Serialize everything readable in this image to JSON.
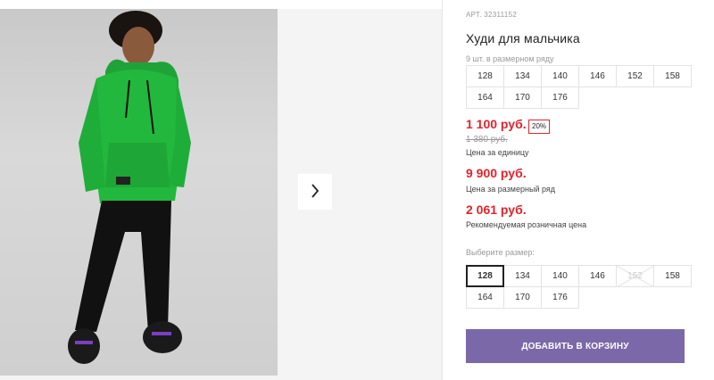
{
  "product": {
    "article_label": "АРТ.",
    "article_number": "32311152",
    "title": "Худи для мальчика",
    "pack_note": "9 шт. в размерном ряду",
    "pack_sizes": [
      "128",
      "134",
      "140",
      "146",
      "152",
      "158",
      "164",
      "170",
      "176"
    ]
  },
  "pricing": {
    "unit_price": "1 100 руб.",
    "discount_badge": "20%",
    "old_price": "1 380 руб.",
    "unit_caption": "Цена за единицу",
    "pack_price": "9 900 руб.",
    "pack_caption": "Цена за размерный ряд",
    "retail_price": "2 061 руб.",
    "retail_caption": "Рекомендуемая розничная цена"
  },
  "size_picker": {
    "label": "Выберите размер:",
    "sizes": [
      {
        "label": "128",
        "state": "selected"
      },
      {
        "label": "134",
        "state": "available"
      },
      {
        "label": "140",
        "state": "available"
      },
      {
        "label": "146",
        "state": "available"
      },
      {
        "label": "152",
        "state": "disabled"
      },
      {
        "label": "158",
        "state": "available"
      },
      {
        "label": "164",
        "state": "available"
      },
      {
        "label": "170",
        "state": "available"
      },
      {
        "label": "176",
        "state": "available"
      }
    ]
  },
  "actions": {
    "add_to_cart": "ДОБАВИТЬ В КОРЗИНУ",
    "next_image_icon": "chevron-right-icon"
  },
  "colors": {
    "price_red": "#e2232d",
    "cart_button": "#7b68a8",
    "hoodie_green": "#22b83d"
  }
}
